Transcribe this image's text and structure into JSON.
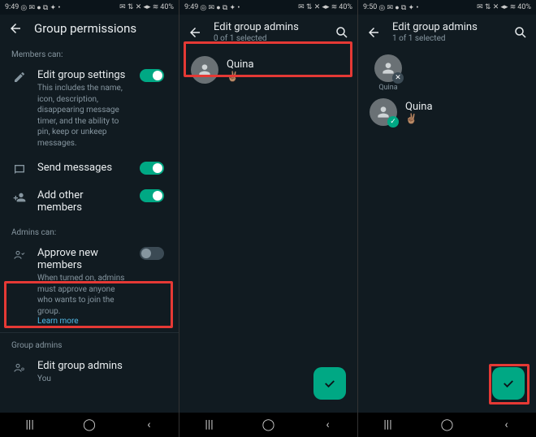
{
  "status": {
    "time_a": "9:49",
    "time_b": "9:49",
    "time_c": "9:50",
    "battery": "40%",
    "left_icons": "◎ ✉ ● ⧉ ✦ •",
    "right_icons": "✉ ⇅ ✕ ◂▸ ≋"
  },
  "screen1": {
    "title": "Group permissions",
    "members_header": "Members can:",
    "edit_settings": {
      "label": "Edit group settings",
      "desc": "This includes the name, icon, description, disappearing message timer, and the ability to pin, keep or unkeep messages."
    },
    "send_messages": "Send messages",
    "add_members": "Add other members",
    "admins_header": "Admins can:",
    "approve": {
      "label": "Approve new members",
      "desc": "When turned on, admins must approve anyone who wants to join the group.",
      "link": "Learn more"
    },
    "group_admins_header": "Group admins",
    "edit_admins": {
      "label": "Edit group admins",
      "sub": "You"
    }
  },
  "screen2": {
    "title": "Edit group admins",
    "subtitle": "0 of 1 selected",
    "contact": {
      "name": "Quina",
      "status": "✌🏽"
    }
  },
  "screen3": {
    "title": "Edit group admins",
    "subtitle": "1 of 1 selected",
    "chip_name": "Quina",
    "contact": {
      "name": "Quina",
      "status": "✌🏽"
    }
  },
  "nav": {
    "recents": "|||",
    "home": "◯",
    "back": "‹"
  }
}
